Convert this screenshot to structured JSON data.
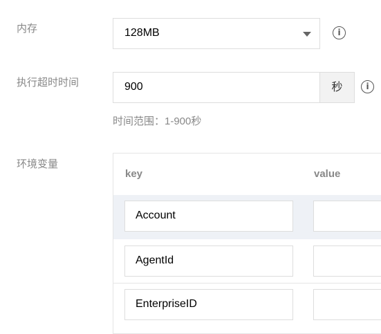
{
  "memory": {
    "label": "内存",
    "value": "128MB"
  },
  "timeout": {
    "label": "执行超时时间",
    "value": "900",
    "unit": "秒",
    "hint": "时间范围：1-900秒"
  },
  "env": {
    "label": "环境变量",
    "columns": {
      "key": "key",
      "value": "value"
    },
    "rows": [
      {
        "key": "Account",
        "value": ""
      },
      {
        "key": "AgentId",
        "value": ""
      },
      {
        "key": "EnterpriseID",
        "value": ""
      }
    ]
  },
  "icons": {
    "info": "info-circle-icon",
    "dropdown": "caret-down-icon"
  }
}
